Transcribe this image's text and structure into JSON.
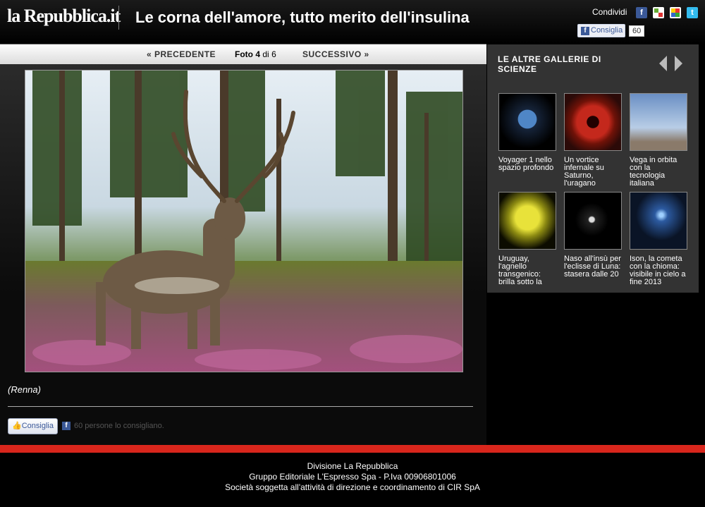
{
  "header": {
    "logo": "la Repubblica.it",
    "title": "Le corna dell'amore, tutto merito dell'insulina",
    "share_label": "Condividi",
    "share_icons": [
      "facebook-icon",
      "oknotizie-icon",
      "google-icon",
      "twitter-icon"
    ],
    "like_button": "Consiglia",
    "like_count": "60"
  },
  "nav": {
    "prev": "« PRECEDENTE",
    "counter_prefix": "Foto",
    "current": "4",
    "separator": "di",
    "total": "6",
    "next": "SUCCESSIVO »"
  },
  "photo": {
    "caption": "(Renna)"
  },
  "social": {
    "like_button": "Consiglia",
    "likes_text": "60 persone lo consigliano."
  },
  "sidebar": {
    "title": "LE ALTRE GALLERIE DI SCIENZE",
    "items": [
      {
        "caption": "Voyager 1 nello spazio profondo"
      },
      {
        "caption": "Un vortice infernale su Saturno, l'uragano"
      },
      {
        "caption": "Vega in orbita con la tecnologia italiana"
      },
      {
        "caption": "Uruguay, l'agnello transgenico: brilla sotto la"
      },
      {
        "caption": "Naso all'insù per l'eclisse di Luna: stasera dalle 20"
      },
      {
        "caption": "Ison, la cometa con la chioma: visibile in cielo a fine 2013"
      }
    ]
  },
  "footer": {
    "line1": "Divisione La Repubblica",
    "line2": "Gruppo Editoriale L'Espresso Spa - P.Iva 00906801006",
    "line3": "Società soggetta all'attività di direzione e coordinamento di CIR SpA"
  },
  "colors": {
    "accent_red": "#d9261c",
    "facebook_blue": "#3b5998"
  }
}
